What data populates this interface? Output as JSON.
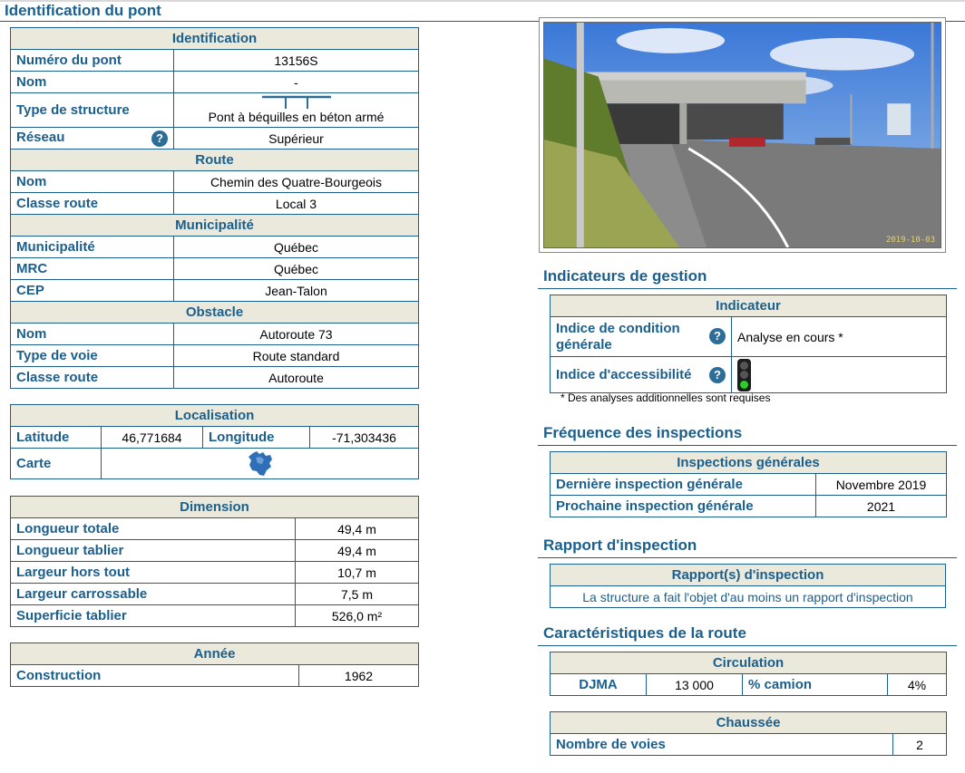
{
  "page_title": "Identification du pont",
  "identification": {
    "header": "Identification",
    "numero_label": "Numéro du pont",
    "numero_value": "13156S",
    "nom_label": "Nom",
    "nom_value": "-",
    "type_label": "Type de structure",
    "type_value": "Pont à béquilles en béton armé",
    "reseau_label": "Réseau",
    "reseau_value": "Supérieur",
    "route_header": "Route",
    "route_nom_label": "Nom",
    "route_nom_value": "Chemin des Quatre-Bourgeois",
    "route_classe_label": "Classe route",
    "route_classe_value": "Local 3",
    "muni_header": "Municipalité",
    "muni_label": "Municipalité",
    "muni_value": "Québec",
    "mrc_label": "MRC",
    "mrc_value": "Québec",
    "cep_label": "CEP",
    "cep_value": "Jean-Talon",
    "obstacle_header": "Obstacle",
    "obs_nom_label": "Nom",
    "obs_nom_value": "Autoroute 73",
    "obs_type_label": "Type de voie",
    "obs_type_value": "Route standard",
    "obs_classe_label": "Classe route",
    "obs_classe_value": "Autoroute"
  },
  "localisation": {
    "header": "Localisation",
    "lat_label": "Latitude",
    "lat_value": "46,771684",
    "lon_label": "Longitude",
    "lon_value": "-71,303436",
    "carte_label": "Carte"
  },
  "dimension": {
    "header": "Dimension",
    "rows": [
      {
        "label": "Longueur totale",
        "value": "49,4 m"
      },
      {
        "label": "Longueur tablier",
        "value": "49,4 m"
      },
      {
        "label": "Largeur hors tout",
        "value": "10,7 m"
      },
      {
        "label": "Largeur carrossable",
        "value": "7,5 m"
      },
      {
        "label": "Superficie tablier",
        "value": "526,0 m²"
      }
    ]
  },
  "annee": {
    "header": "Année",
    "label": "Construction",
    "value": "1962"
  },
  "photo": {
    "date": "2019-10-03"
  },
  "indicateurs": {
    "title": "Indicateurs de gestion",
    "header": "Indicateur",
    "icg_label": "Indice de condition générale",
    "icg_value": "Analyse en cours *",
    "acc_label": "Indice d'accessibilité",
    "footnote": "* Des analyses additionnelles sont requises"
  },
  "frequence": {
    "title": "Fréquence des inspections",
    "header": "Inspections générales",
    "derniere_label": "Dernière inspection générale",
    "derniere_value": "Novembre 2019",
    "prochaine_label": "Prochaine inspection générale",
    "prochaine_value": "2021"
  },
  "rapport": {
    "title": "Rapport d'inspection",
    "header": "Rapport(s) d'inspection",
    "text": "La structure a fait l'objet d'au moins un rapport d'inspection"
  },
  "route_carac": {
    "title": "Caractéristiques de la route",
    "circ_header": "Circulation",
    "djma_label": "DJMA",
    "djma_value": "13 000",
    "camion_label": "% camion",
    "camion_value": "4%",
    "chaussee_header": "Chaussée",
    "voies_label": "Nombre de voies",
    "voies_value": "2"
  },
  "colors": {
    "accent": "#1b5f8d",
    "header_bg": "#ebe9dc",
    "light_green": "#26d026"
  }
}
